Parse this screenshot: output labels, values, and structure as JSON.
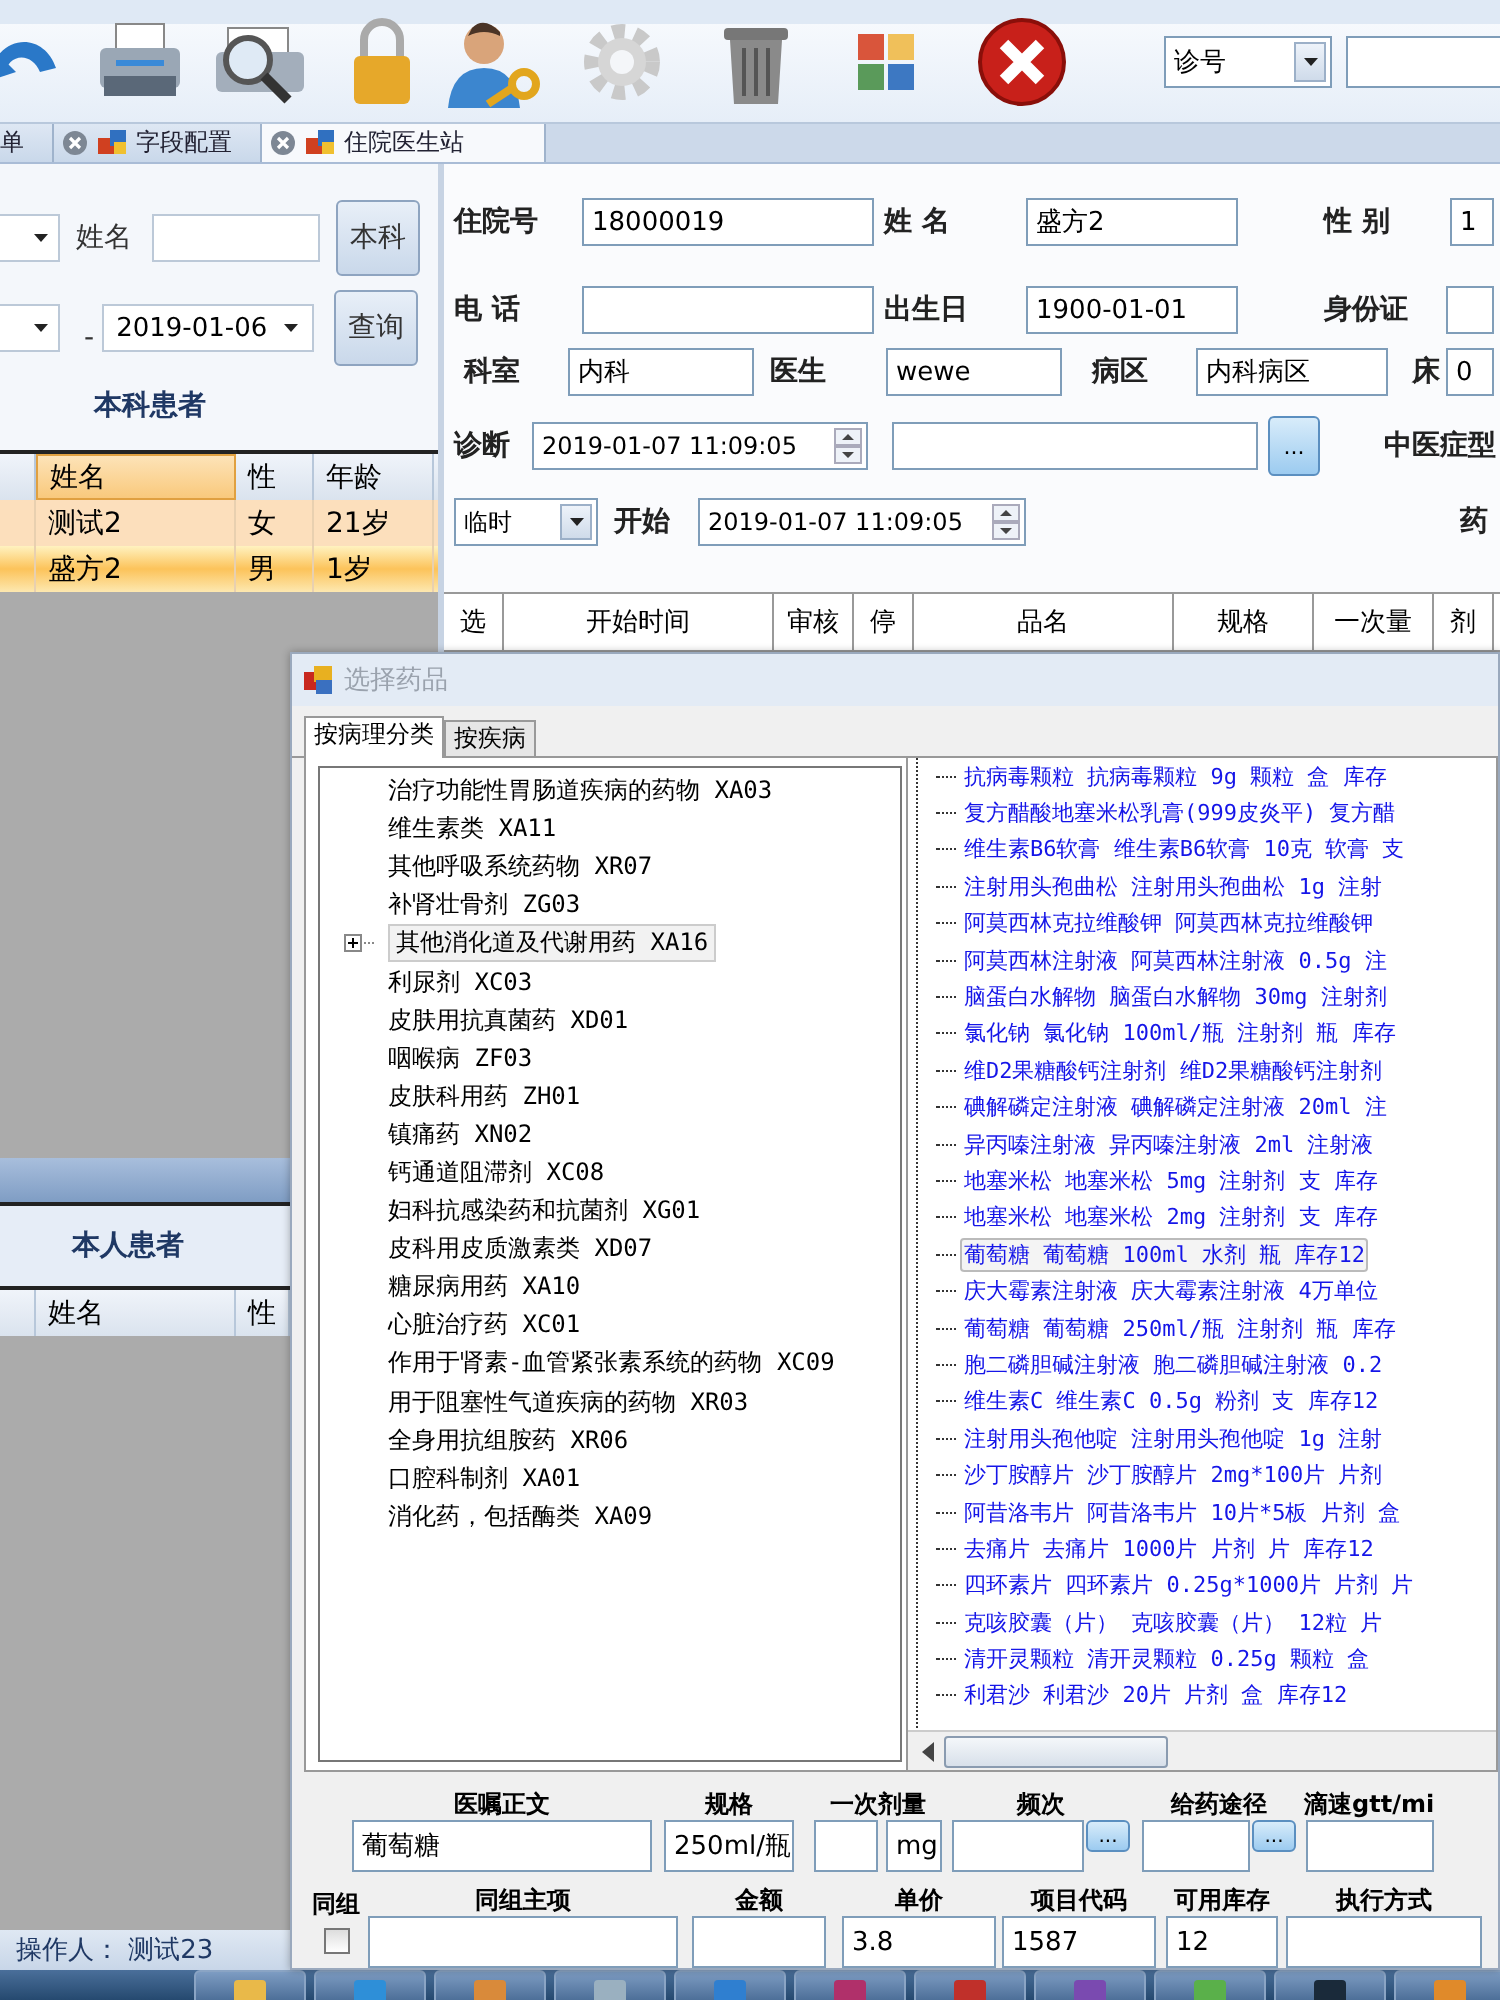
{
  "toolbar": {
    "search_type": "诊号"
  },
  "tabs": [
    {
      "label": "单",
      "selected": false
    },
    {
      "label": "字段配置",
      "selected": false
    },
    {
      "label": "住院医生站",
      "selected": true
    }
  ],
  "patient_filter": {
    "name_label": "姓名",
    "dept_button": "本科",
    "date_separator": "-",
    "date_to": "2019-01-06",
    "query_button": "查询"
  },
  "dept_patients": {
    "title": "本科患者",
    "columns": [
      "姓名",
      "性",
      "年龄"
    ],
    "rows": [
      {
        "cells": [
          "测试2",
          "女",
          "21岁"
        ],
        "selected": false
      },
      {
        "cells": [
          "盛方2",
          "男",
          "1岁"
        ],
        "selected": true
      }
    ]
  },
  "own_patients": {
    "title": "本人患者",
    "columns": [
      "姓名",
      "性"
    ]
  },
  "patient_form": {
    "fields": [
      {
        "kind": "text",
        "label": "住院号",
        "value": "18000019"
      },
      {
        "kind": "text",
        "label": "姓 名",
        "value": "盛方2"
      },
      {
        "kind": "text",
        "label": "性 别",
        "value": "1"
      },
      {
        "kind": "text",
        "label": "电 话"
      },
      {
        "kind": "text",
        "label": "出生日",
        "value": "1900-01-01"
      },
      {
        "kind": "text",
        "label": "身份证"
      },
      {
        "kind": "text",
        "label": "科室",
        "value": "内科"
      },
      {
        "kind": "text",
        "label": "医生",
        "value": "wewe"
      },
      {
        "kind": "text",
        "label": "病区",
        "value": "内科病区"
      },
      {
        "kind": "text",
        "label": "床",
        "value": "0"
      },
      {
        "kind": "spin",
        "label": "诊断",
        "value": "2019-01-07 11:09:05"
      },
      {
        "kind": "picker",
        "button": "..."
      },
      {
        "kind": "label",
        "label": "中医症型"
      },
      {
        "kind": "combo",
        "value": "临时"
      },
      {
        "kind": "spin",
        "label": "开始",
        "value": "2019-01-07  11:09:05"
      },
      {
        "kind": "label",
        "label": "药"
      }
    ]
  },
  "orders_table": {
    "columns": [
      "选",
      "开始时间",
      "审核",
      "停",
      "品名",
      "规格",
      "一次量",
      "剂"
    ]
  },
  "dialog": {
    "title": "选择药品",
    "tabs": [
      {
        "label": "按病理分类",
        "selected": true
      },
      {
        "label": "按疾病",
        "selected": false
      }
    ],
    "categories": [
      {
        "label": "治疗功能性胃肠道疾病的药物 XA03",
        "kind": "leaf",
        "selected": false
      },
      {
        "label": "维生素类 XA11",
        "kind": "leaf",
        "selected": false
      },
      {
        "label": "其他呼吸系统药物 XR07",
        "kind": "leaf",
        "selected": false
      },
      {
        "label": "补肾壮骨剂 ZG03",
        "kind": "leaf",
        "selected": false
      },
      {
        "label": "其他消化道及代谢用药 XA16",
        "kind": "group",
        "expanded": false,
        "selected": true
      },
      {
        "label": "利尿剂 XC03",
        "kind": "leaf",
        "selected": false
      },
      {
        "label": "皮肤用抗真菌药 XD01",
        "kind": "leaf",
        "selected": false
      },
      {
        "label": "咽喉病 ZF03",
        "kind": "leaf",
        "selected": false
      },
      {
        "label": "皮肤科用药 ZH01",
        "kind": "leaf",
        "selected": false
      },
      {
        "label": "镇痛药 XN02",
        "kind": "leaf",
        "selected": false
      },
      {
        "label": "钙通道阻滞剂 XC08",
        "kind": "leaf",
        "selected": false
      },
      {
        "label": "妇科抗感染药和抗菌剂 XG01",
        "kind": "leaf",
        "selected": false
      },
      {
        "label": "皮科用皮质激素类 XD07",
        "kind": "leaf",
        "selected": false
      },
      {
        "label": "糖尿病用药 XA10",
        "kind": "leaf",
        "selected": false
      },
      {
        "label": "心脏治疗药 XC01",
        "kind": "leaf",
        "selected": false
      },
      {
        "label": "作用于肾素-血管紧张素系统的药物 XC09",
        "kind": "leaf",
        "selected": false
      },
      {
        "label": "用于阻塞性气道疾病的药物 XR03",
        "kind": "leaf",
        "selected": false
      },
      {
        "label": "全身用抗组胺药 XR06",
        "kind": "leaf",
        "selected": false
      },
      {
        "label": "口腔科制剂 XA01",
        "kind": "leaf",
        "selected": false
      },
      {
        "label": "消化药，包括酶类 XA09",
        "kind": "leaf",
        "selected": false
      }
    ],
    "drugs": [
      {
        "label": "抗病毒颗粒 抗病毒颗粒 9g 颗粒 盒 库存",
        "selected": false
      },
      {
        "label": "复方醋酸地塞米松乳膏(999皮炎平) 复方醋",
        "selected": false
      },
      {
        "label": "维生素B6软膏 维生素B6软膏 10克 软膏 支",
        "selected": false
      },
      {
        "label": "注射用头孢曲松 注射用头孢曲松 1g 注射",
        "selected": false
      },
      {
        "label": "阿莫西林克拉维酸钾 阿莫西林克拉维酸钾",
        "selected": false
      },
      {
        "label": "阿莫西林注射液 阿莫西林注射液 0.5g 注",
        "selected": false
      },
      {
        "label": "脑蛋白水解物 脑蛋白水解物 30mg 注射剂",
        "selected": false
      },
      {
        "label": "氯化钠 氯化钠 100ml/瓶 注射剂 瓶 库存",
        "selected": false
      },
      {
        "label": "维D2果糖酸钙注射剂 维D2果糖酸钙注射剂",
        "selected": false
      },
      {
        "label": "碘解磷定注射液 碘解磷定注射液 20ml 注",
        "selected": false
      },
      {
        "label": "异丙嗪注射液 异丙嗪注射液 2ml 注射液",
        "selected": false
      },
      {
        "label": "地塞米松 地塞米松 5mg 注射剂 支 库存",
        "selected": false
      },
      {
        "label": "地塞米松 地塞米松 2mg 注射剂 支 库存",
        "selected": false
      },
      {
        "label": "葡萄糖 葡萄糖 100ml 水剂 瓶 库存12",
        "selected": true
      },
      {
        "label": "庆大霉素注射液 庆大霉素注射液 4万单位",
        "selected": false
      },
      {
        "label": "葡萄糖 葡萄糖 250ml/瓶 注射剂 瓶 库存",
        "selected": false
      },
      {
        "label": "胞二磷胆碱注射液 胞二磷胆碱注射液 0.2",
        "selected": false
      },
      {
        "label": "维生素C 维生素C 0.5g 粉剂 支 库存12",
        "selected": false
      },
      {
        "label": "注射用头孢他啶 注射用头孢他啶 1g 注射",
        "selected": false
      },
      {
        "label": "沙丁胺醇片 沙丁胺醇片 2mg*100片 片剂",
        "selected": false
      },
      {
        "label": "阿昔洛韦片 阿昔洛韦片 10片*5板 片剂 盒",
        "selected": false
      },
      {
        "label": "去痛片 去痛片 1000片 片剂 片 库存12",
        "selected": false
      },
      {
        "label": "四环素片 四环素片 0.25g*1000片 片剂 片",
        "selected": false
      },
      {
        "label": "克咳胶囊（片） 克咳胶囊（片） 12粒 片",
        "selected": false
      },
      {
        "label": "清开灵颗粒 清开灵颗粒 0.25g 颗粒 盒",
        "selected": false
      },
      {
        "label": "利君沙 利君沙 20片 片剂 盒 库存12",
        "selected": false
      }
    ],
    "order_form": {
      "fields": [
        {
          "kind": "text",
          "label": "医嘱正文",
          "value": "葡萄糖"
        },
        {
          "kind": "text",
          "label": "规格",
          "value": "250ml/瓶"
        },
        {
          "kind": "dose",
          "label": "一次剂量",
          "unit": "mg"
        },
        {
          "kind": "picker",
          "label": "频次",
          "button": "..."
        },
        {
          "kind": "picker",
          "label": "给药途径",
          "button": "..."
        },
        {
          "kind": "text",
          "label": "滴速gtt/mi"
        },
        {
          "kind": "check",
          "label": "同组",
          "checked": false
        },
        {
          "kind": "text",
          "label": "同组主项"
        },
        {
          "kind": "text",
          "label": "金额"
        },
        {
          "kind": "text",
          "label": "单价",
          "value": "3.8"
        },
        {
          "kind": "text",
          "label": "项目代码",
          "value": "1587"
        },
        {
          "kind": "text",
          "label": "可用库存",
          "value": "12"
        },
        {
          "kind": "text",
          "label": "执行方式"
        }
      ]
    }
  },
  "status_bar": {
    "operator": "操作人： 测试23"
  }
}
